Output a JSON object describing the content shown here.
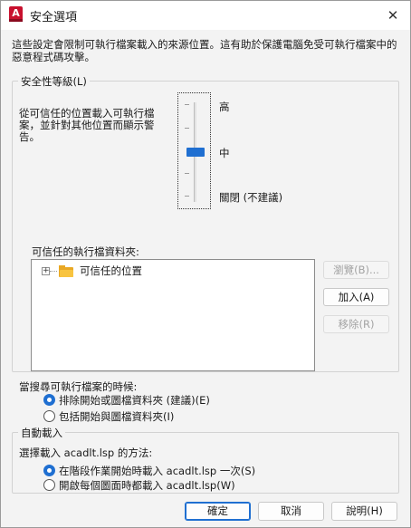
{
  "window": {
    "app_icon_letter": "A",
    "title": "安全選項",
    "close_glyph": "✕"
  },
  "intro": "這些設定會限制可執行檔案載入的來源位置。這有助於保護電腦免受可執行檔案中的惡意程式碼攻擊。",
  "security_level": {
    "legend": "安全性等級(L)",
    "description": "從可信任的位置載入可執行檔案，並針對其他位置而顯示警告。",
    "levels": [
      "高",
      "中",
      "關閉 (不建議)"
    ],
    "selected": "中"
  },
  "trusted_folders": {
    "label": "可信任的執行檔資料夾:",
    "tree_expander": "+",
    "tree_item": "可信任的位置",
    "buttons": {
      "browse": "瀏覽(B)...",
      "add": "加入(A)",
      "remove": "移除(R)"
    }
  },
  "search": {
    "label": "當搜尋可執行檔案的時候:",
    "options": [
      {
        "label": "排除開始或圖檔資料夾 (建議)(E)",
        "checked": true
      },
      {
        "label": "包括開始與圖檔資料夾(I)",
        "checked": false
      }
    ]
  },
  "autoload": {
    "legend": "自動載入",
    "label": "選擇載入 acadlt.lsp 的方法:",
    "options": [
      {
        "label": "在階段作業開始時載入 acadlt.lsp 一次(S)",
        "checked": true
      },
      {
        "label": "開啟每個圖面時都載入 acadlt.lsp(W)",
        "checked": false
      }
    ]
  },
  "footer": {
    "ok": "確定",
    "cancel": "取消",
    "help": "說明(H)"
  },
  "colors": {
    "accent": "#1f6fd1",
    "app_icon": "#c8102e",
    "folder": "#f8c440"
  }
}
